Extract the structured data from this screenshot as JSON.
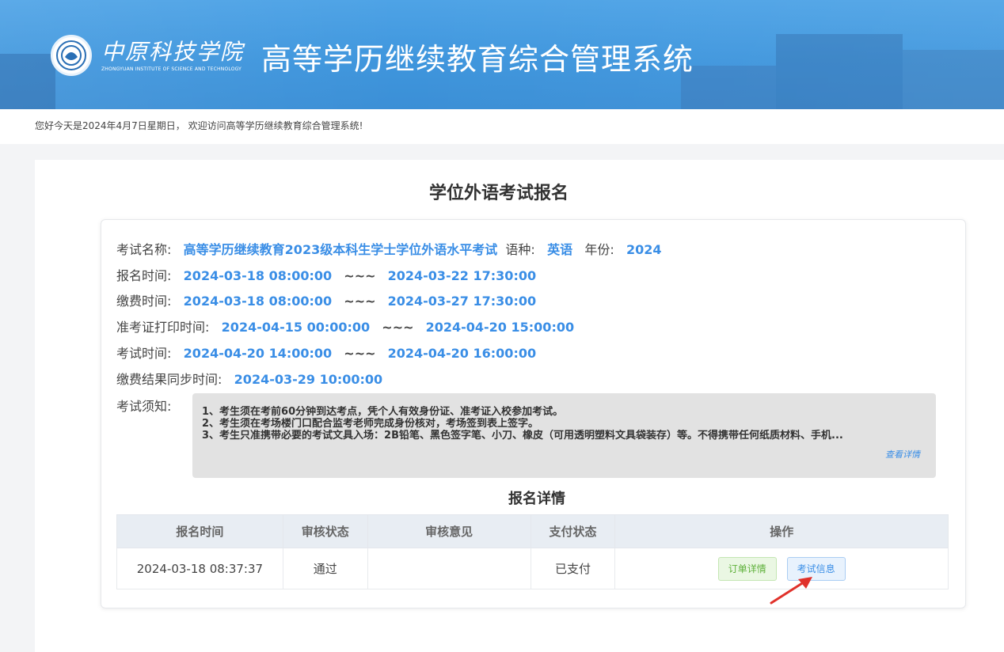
{
  "header": {
    "school_name_cn": "中原科技学院",
    "school_name_en": "ZHONGYUAN INSTITUTE OF SCIENCE AND TECHNOLOGY",
    "system_title": "高等学历继续教育综合管理系统"
  },
  "welcome_text": "您好今天是2024年4月7日星期日， 欢迎访问高等学历继续教育综合管理系统!",
  "page_title": "学位外语考试报名",
  "exam": {
    "name_label": "考试名称:",
    "name_value": "高等学历继续教育2023级本科生学士学位外语水平考试",
    "language_label": "语种:",
    "language_value": "英语",
    "year_label": "年份:",
    "year_value": "2024",
    "signup_label": "报名时间:",
    "signup_start": "2024-03-18 08:00:00",
    "signup_end": "2024-03-22 17:30:00",
    "payment_label": "缴费时间:",
    "payment_start": "2024-03-18 08:00:00",
    "payment_end": "2024-03-27 17:30:00",
    "admit_print_label": "准考证打印时间:",
    "admit_print_start": "2024-04-15 00:00:00",
    "admit_print_end": "2024-04-20 15:00:00",
    "exam_time_label": "考试时间:",
    "exam_time_start": "2024-04-20 14:00:00",
    "exam_time_end": "2024-04-20 16:00:00",
    "sync_label": "缴费结果同步时间:",
    "sync_value": "2024-03-29 10:00:00",
    "range_sep": "~~~"
  },
  "notice": {
    "label": "考试须知:",
    "lines": [
      "1、考生须在考前60分钟到达考点，凭个人有效身份证、准考证入校参加考试。",
      "2、考生须在考场楼门口配合监考老师完成身份核对，考场签到表上签字。",
      "3、考生只准携带必要的考试文具入场：2B铅笔、黑色签字笔、小刀、橡皮（可用透明塑料文具袋装存）等。不得携带任何纸质材料、手机..."
    ],
    "more_link": "查看详情"
  },
  "registration": {
    "section_title": "报名详情",
    "columns": [
      "报名时间",
      "审核状态",
      "审核意见",
      "支付状态",
      "操作"
    ],
    "rows": [
      {
        "time": "2024-03-18 08:37:37",
        "review_status": "通过",
        "review_comment": "",
        "pay_status": "已支付",
        "actions": [
          "订单详情",
          "考试信息"
        ]
      }
    ]
  },
  "colors": {
    "accent": "#3a8ee6",
    "banner": "#3f96dd",
    "success": "#5fb13b",
    "arrow": "#e0312a"
  }
}
